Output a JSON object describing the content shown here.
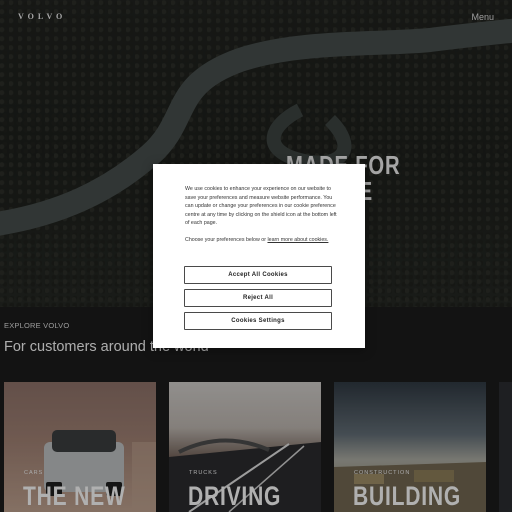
{
  "header": {
    "logo_text": "VOLVO",
    "menu_label": "Menu"
  },
  "hero": {
    "headline_line1": "MADE FOR PEOPLE",
    "headline_line2": "LE"
  },
  "section": {
    "eyebrow": "EXPLORE VOLVO",
    "title": "For customers around the world"
  },
  "cards": [
    {
      "category": "CARS",
      "headline": "THE NEW"
    },
    {
      "category": "TRUCKS",
      "headline": "DRIVING"
    },
    {
      "category": "CONSTRUCTION",
      "headline": "BUILDING"
    }
  ],
  "cookie_modal": {
    "body_text": "We use cookies to enhance your experience on our website to save your preferences and measure website performance. You can update or change your preferences in our cookie preference centre at any time by clicking on the shield icon at the bottom left of each page.",
    "choose_text": "Choose your preferences below or",
    "learn_more_link": "learn more about cookies.",
    "accept_label": "Accept All Cookies",
    "reject_label": "Reject All",
    "settings_label": "Cookies Settings"
  }
}
